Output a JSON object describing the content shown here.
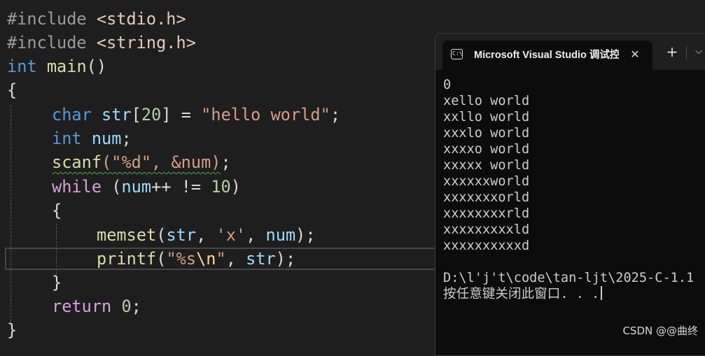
{
  "editor": {
    "include_stdio": "#include",
    "header_stdio": "<stdio.h>",
    "include_string": "#include",
    "header_string": "<string.h>",
    "kw_int": "int",
    "fn_main": "main",
    "main_parens": "()",
    "brace_open": "{",
    "kw_char": "char",
    "var_str": "str",
    "bracket_open": "[",
    "num_20": "20",
    "bracket_close": "]",
    "eq": " = ",
    "str_hello": "\"hello world\"",
    "semicolon": ";",
    "kw_int2": "int",
    "var_num": "num",
    "fn_scanf": "scanf",
    "scanf_args": "(\"%d\", &num)",
    "kw_while": "while",
    "while_open": " (",
    "var_num2": "num",
    "while_op": "++ != ",
    "num_10": "10",
    "while_close": ")",
    "inner_brace_open": "{",
    "fn_memset": "memset",
    "memset_paren": "(",
    "var_str2": "str",
    "comma1": ", ",
    "chr_x": "'x'",
    "comma2": ", ",
    "var_num3": "num",
    "memset_end": ");",
    "fn_printf": "printf",
    "printf_paren": "(",
    "str_fmt_open": "\"%s",
    "esc_n": "\\n",
    "str_fmt_close": "\"",
    "comma3": ", ",
    "var_str3": "str",
    "printf_end": ");",
    "inner_brace_close": "}",
    "kw_return": "return",
    "num_0": "0",
    "return_end": ";",
    "brace_close": "}"
  },
  "console": {
    "tab_title": "Microsoft Visual Studio 调试控制台",
    "tab_close": "✕",
    "new_tab": "+",
    "dropdown": "⌵",
    "lines": [
      "0",
      "xello world",
      "xxllo world",
      "xxxlo world",
      "xxxxo world",
      "xxxxx world",
      "xxxxxxworld",
      "xxxxxxxorld",
      "xxxxxxxxrld",
      "xxxxxxxxxld",
      "xxxxxxxxxxd",
      "",
      "D:\\l'j't\\code\\tan-ljt\\2025-C-1.1",
      "按任意键关闭此窗口. . ."
    ]
  },
  "watermark": "CSDN @@曲终"
}
